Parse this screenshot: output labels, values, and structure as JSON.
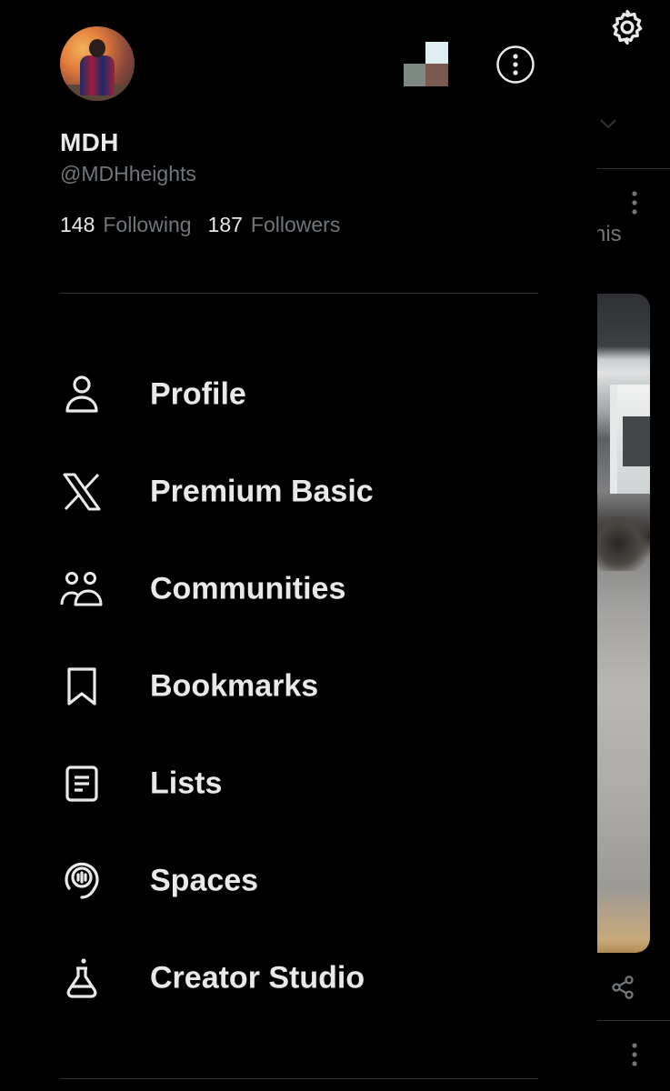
{
  "profile": {
    "display_name": "MDH",
    "handle": "@MDHheights",
    "following_count": "148",
    "following_label": "Following",
    "followers_count": "187",
    "followers_label": "Followers"
  },
  "menu": {
    "items": [
      {
        "label": "Profile",
        "icon": "person-icon"
      },
      {
        "label": "Premium Basic",
        "icon": "x-logo-icon"
      },
      {
        "label": "Communities",
        "icon": "communities-icon"
      },
      {
        "label": "Bookmarks",
        "icon": "bookmark-icon"
      },
      {
        "label": "Lists",
        "icon": "list-icon"
      },
      {
        "label": "Spaces",
        "icon": "spaces-icon"
      },
      {
        "label": "Creator Studio",
        "icon": "flask-icon"
      }
    ]
  },
  "background_feed": {
    "text_fragment": "nis"
  },
  "colors": {
    "background": "#000000",
    "primary_text": "#e7e9ea",
    "secondary_text": "#71767b",
    "divider": "#2f3336"
  }
}
